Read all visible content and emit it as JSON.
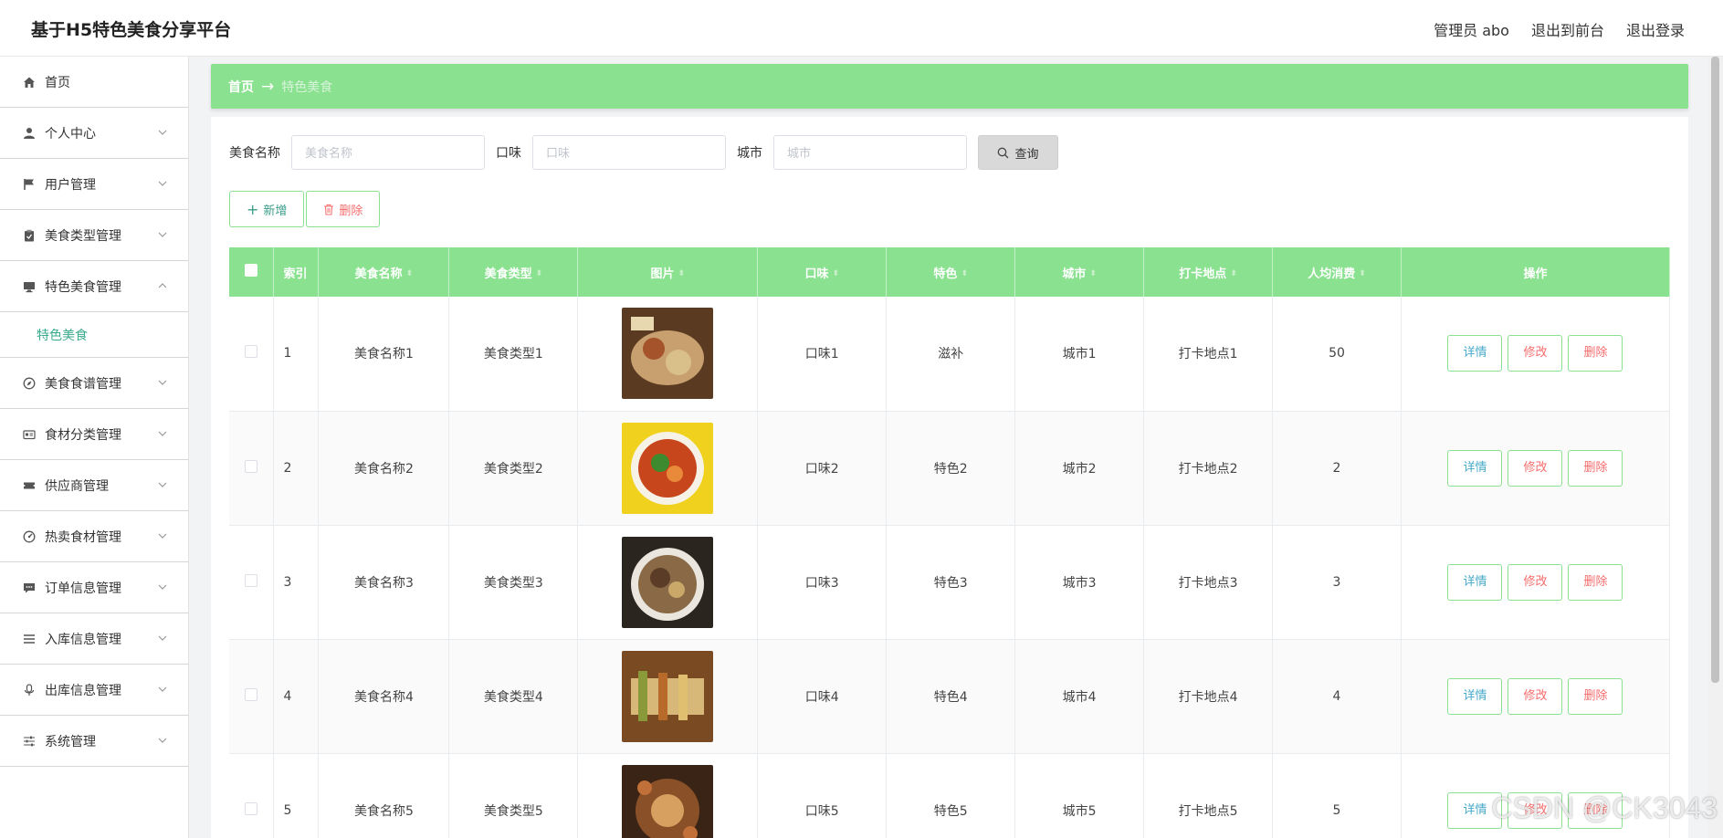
{
  "app": {
    "title": "基于H5特色美食分享平台",
    "top_links": [
      "管理员 abo",
      "退出到前台",
      "退出登录"
    ]
  },
  "sidebar": {
    "items": [
      {
        "label": "首页",
        "icon": "home-icon",
        "expandable": false
      },
      {
        "label": "个人中心",
        "icon": "user-icon",
        "expandable": true
      },
      {
        "label": "用户管理",
        "icon": "flag-icon",
        "expandable": true
      },
      {
        "label": "美食类型管理",
        "icon": "clipboard-icon",
        "expandable": true
      },
      {
        "label": "特色美食管理",
        "icon": "monitor-icon",
        "expandable": true,
        "expanded": true
      },
      {
        "label": "美食食谱管理",
        "icon": "compass-icon",
        "expandable": true
      },
      {
        "label": "食材分类管理",
        "icon": "card-icon",
        "expandable": true
      },
      {
        "label": "供应商管理",
        "icon": "ticket-icon",
        "expandable": true
      },
      {
        "label": "热卖食材管理",
        "icon": "gauge-icon",
        "expandable": true
      },
      {
        "label": "订单信息管理",
        "icon": "chat-icon",
        "expandable": true
      },
      {
        "label": "入库信息管理",
        "icon": "list-icon",
        "expandable": true
      },
      {
        "label": "出库信息管理",
        "icon": "mic-icon",
        "expandable": true
      },
      {
        "label": "系统管理",
        "icon": "sliders-icon",
        "expandable": true
      }
    ],
    "sub_item": "特色美食"
  },
  "breadcrumb": {
    "home": "首页",
    "arrow": "→",
    "current": "特色美食"
  },
  "search": {
    "fields": [
      {
        "label": "美食名称",
        "placeholder": "美食名称"
      },
      {
        "label": "口味",
        "placeholder": "口味"
      },
      {
        "label": "城市",
        "placeholder": "城市"
      }
    ],
    "query_button": "查询"
  },
  "actions": {
    "add": "新增",
    "delete": "删除"
  },
  "table": {
    "headers": [
      "索引",
      "美食名称",
      "美食类型",
      "图片",
      "口味",
      "特色",
      "城市",
      "打卡地点",
      "人均消费",
      "操作"
    ],
    "rows": [
      {
        "index": "1",
        "name": "美食名称1",
        "type": "美食类型1",
        "taste": "口味1",
        "feature": "滋补",
        "city": "城市1",
        "place": "打卡地点1",
        "cost": "50"
      },
      {
        "index": "2",
        "name": "美食名称2",
        "type": "美食类型2",
        "taste": "口味2",
        "feature": "特色2",
        "city": "城市2",
        "place": "打卡地点2",
        "cost": "2"
      },
      {
        "index": "3",
        "name": "美食名称3",
        "type": "美食类型3",
        "taste": "口味3",
        "feature": "特色3",
        "city": "城市3",
        "place": "打卡地点3",
        "cost": "3"
      },
      {
        "index": "4",
        "name": "美食名称4",
        "type": "美食类型4",
        "taste": "口味4",
        "feature": "特色4",
        "city": "城市4",
        "place": "打卡地点4",
        "cost": "4"
      },
      {
        "index": "5",
        "name": "美食名称5",
        "type": "美食类型5",
        "taste": "口味5",
        "feature": "特色5",
        "city": "城市5",
        "place": "打卡地点5",
        "cost": "5"
      }
    ],
    "ops": {
      "detail": "详情",
      "edit": "修改",
      "delete": "删除"
    }
  },
  "watermark": "CSDN @CK3043",
  "colors": {
    "accent": "#8ae18f",
    "link": "#47a9c9",
    "danger": "#f56c6c",
    "sub_active": "#3aaa8c"
  }
}
